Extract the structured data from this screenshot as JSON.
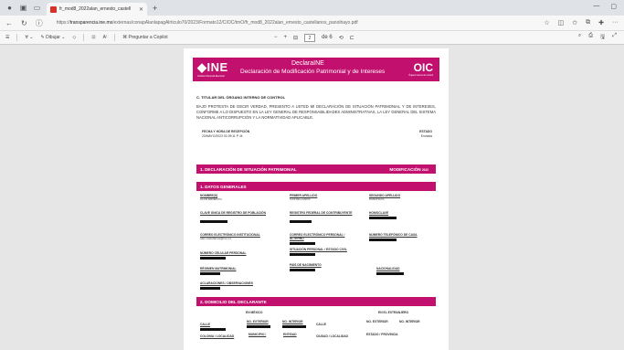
{
  "browser": {
    "tab_title": "fr_mod8_2022alan_ernesto_castell",
    "url_prefix": "https://",
    "url_domain": "transparencia.ine.mx",
    "url_path": "/externas/conapAlanlapagAlrticulo70/2023/Formato12/CIOC/tmO/fr_mod8_2022alan_ernesto_castellanos_panoihayo.pdf"
  },
  "pdf_toolbar": {
    "draw_label": "Dibujar",
    "copilot_label": "Preguntar a Copilot",
    "page_current": "2",
    "page_total": "de 6"
  },
  "document": {
    "header": {
      "org": "INE",
      "org_sub": "Instituto Nacional Electoral",
      "title_line1": "DeclaraINE",
      "title_line2": "Declaración de Modificación Patrimonial y de Intereses",
      "oic": "OIC",
      "oic_sub": "Órgano Interno de Control"
    },
    "section_c_title": "C. TITULAR DEL ÓRGANO INTERNO DE CONTROL",
    "protesta": "BAJO PROTESTA DE DECIR VERDAD, PRESENTO A USTED MI DECLARACIÓN DE SITUACIÓN PATRIMONIAL Y DE INTERESES, CONFORME A LO DISPUESTO EN LA LEY GENERAL DE RESPONSABILIDADES ADMINISTRATIVAS, LA LEY GENERAL DEL SISTEMA NACIONAL ANTICORRUPCIÓN Y LA NORMATIVIDAD APLICABLE.",
    "fecha_label": "FECHA Y HORA DE RECEPCIÓN",
    "fecha_value": "23/MAYO/2023 01:09:11 P. M.",
    "estado_label": "ESTADO",
    "estado_value": "Enviada",
    "bar1_label": "1. DECLARACIÓN DE SITUACIÓN PATRIMONIAL",
    "bar1_right": "MODIFICACIÓN",
    "bar1_year": "2022",
    "bar2_label": "1. DATOS GENERALES",
    "bar3_label": "2. DOMICILIO DEL DECLARANTE",
    "fields": {
      "nombres_label": "NOMBRE(S)",
      "nombres_value": "ALAN ERNESTO",
      "primer_ap_label": "PRIMER APELLIDO",
      "primer_ap_value": "CASTELLANOS",
      "segundo_ap_label": "SEGUNDO APELLIDO",
      "segundo_ap_value": "PANOHAYA",
      "curp_label": "CLAVE ÚNICA DE REGISTRO DE POBLACIÓN",
      "rfc_label": "REGISTRO FEDERAL DE CONTRIBUYENTE",
      "homoclave_label": "HOMOCLAVE",
      "correo_inst_label": "CORREO ELECTRÓNICO INSTITUCIONAL",
      "correo_inst_value": "alan.castellanos@ine.mx",
      "correo_pers_label": "CORREO ELECTRÓNICO PERSONAL / ALTERNO",
      "tel_casa_label": "NÚMERO TELEFÓNICO DE CASA",
      "celular_label": "NÚMERO CELULAR PERSONAL",
      "sit_personal_label": "SITUACIÓN PERSONAL / ESTADO CIVIL",
      "regimen_label": "RÉGIMEN MATRIMONIAL",
      "pais_label": "PAÍS DE NACIMIENTO",
      "nacionalidad_label": "NACIONALIDAD",
      "aclaraciones_label": "ACLARACIONES / OBSERVACIONES"
    },
    "domicilio": {
      "mexico_label": "EN MÉXICO",
      "extranjero_label": "EN EL EXTRANJERO",
      "calle_label": "CALLE",
      "no_ext_label": "NO. EXTERIOR",
      "no_int_label": "NO. INTERIOR",
      "calle2_label": "CALLE",
      "no_ext2_label": "NO. EXTERIOR",
      "no_int2_label": "NO. INTERIOR",
      "colonia_label": "COLONIA / LOCALIDAD",
      "municipio_label": "MUNICIPIO /",
      "entidad_label": "ENTIDAD",
      "ciudad_label": "CIUDAD / LOCALIDAD",
      "estado_prov_label": "ESTADO / PROVINCIA"
    }
  },
  "colors": {
    "brand": "#c2106f"
  }
}
